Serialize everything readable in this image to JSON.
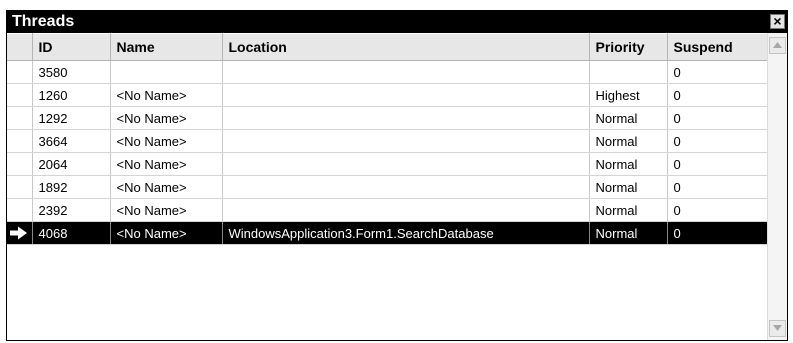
{
  "window": {
    "title": "Threads",
    "close_glyph": "×"
  },
  "columns": [
    "",
    "ID",
    "Name",
    "Location",
    "Priority",
    "Suspend"
  ],
  "rows": [
    {
      "id": "3580",
      "name": "",
      "location": "",
      "priority": "",
      "suspend": "0",
      "current": false
    },
    {
      "id": "1260",
      "name": "<No Name>",
      "location": "",
      "priority": "Highest",
      "suspend": "0",
      "current": false
    },
    {
      "id": "1292",
      "name": "<No Name>",
      "location": "",
      "priority": "Normal",
      "suspend": "0",
      "current": false
    },
    {
      "id": "3664",
      "name": "<No Name>",
      "location": "",
      "priority": "Normal",
      "suspend": "0",
      "current": false
    },
    {
      "id": "2064",
      "name": "<No Name>",
      "location": "",
      "priority": "Normal",
      "suspend": "0",
      "current": false
    },
    {
      "id": "1892",
      "name": "<No Name>",
      "location": "",
      "priority": "Normal",
      "suspend": "0",
      "current": false
    },
    {
      "id": "2392",
      "name": "<No Name>",
      "location": "",
      "priority": "Normal",
      "suspend": "0",
      "current": false
    },
    {
      "id": "4068",
      "name": "<No Name>",
      "location": "WindowsApplication3.Form1.SearchDatabase",
      "priority": "Normal",
      "suspend": "0",
      "current": true
    }
  ],
  "icons": {
    "current_row": "arrow-right-icon",
    "close": "close-icon",
    "scroll_up": "triangle-up-icon",
    "scroll_down": "triangle-down-icon"
  },
  "colors": {
    "titlebar": "#000000",
    "selected_row": "#000000",
    "header_bg": "#e7e7e7"
  }
}
